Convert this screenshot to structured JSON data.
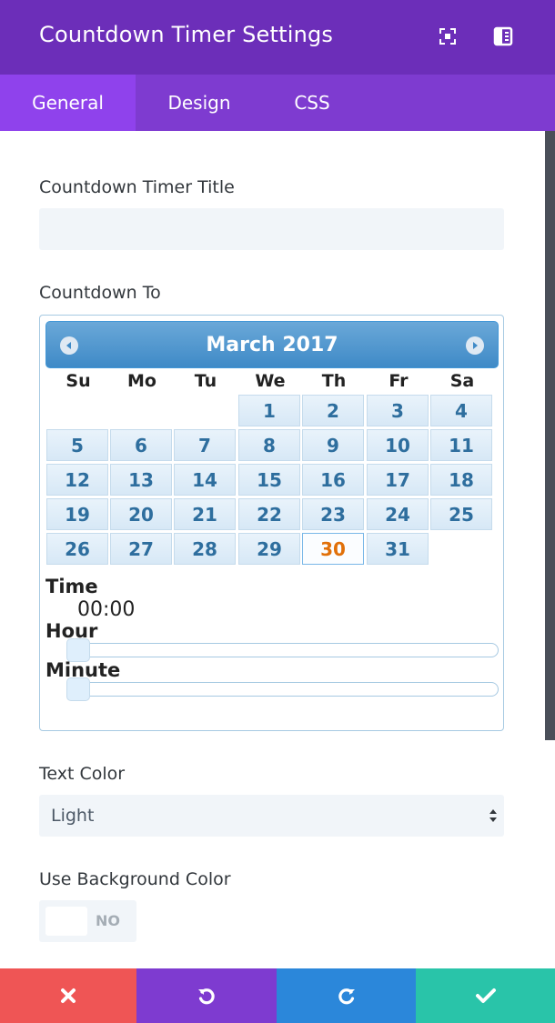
{
  "header": {
    "title": "Countdown Timer Settings",
    "expand_icon": "expand-icon",
    "split_icon": "split-view-icon",
    "bg_color": "#6c2eb9"
  },
  "tabs": [
    {
      "label": "General",
      "active": true
    },
    {
      "label": "Design",
      "active": false
    },
    {
      "label": "CSS",
      "active": false
    }
  ],
  "fields": {
    "title_label": "Countdown Timer Title",
    "title_value": "",
    "countdown_to_label": "Countdown To",
    "text_color_label": "Text Color",
    "text_color_value": "Light",
    "use_bg_label": "Use Background Color",
    "use_bg_toggle": "NO"
  },
  "calendar": {
    "month_year": "March 2017",
    "weekdays": [
      "Su",
      "Mo",
      "Tu",
      "We",
      "Th",
      "Fr",
      "Sa"
    ],
    "first_weekday_index": 3,
    "days_in_month": 31,
    "selected_day": 30,
    "time_label": "Time",
    "time_value": "00:00",
    "hour_label": "Hour",
    "minute_label": "Minute",
    "hour_value": 0,
    "minute_value": 0
  },
  "footer": {
    "cancel_icon": "close-icon",
    "undo_icon": "undo-icon",
    "redo_icon": "redo-icon",
    "save_icon": "check-icon"
  }
}
